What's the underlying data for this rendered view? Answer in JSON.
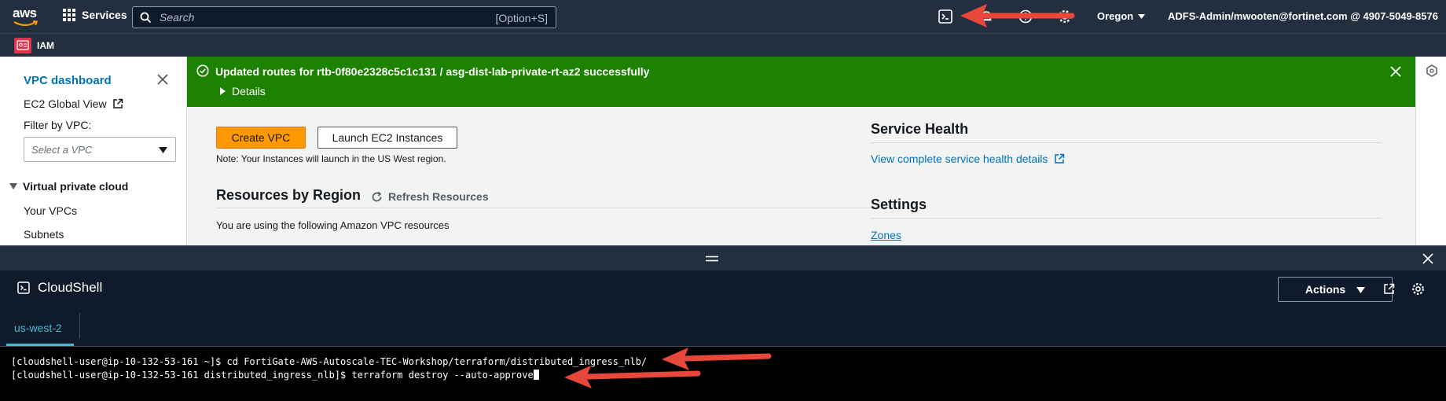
{
  "topnav": {
    "logo_text": "aws",
    "services_label": "Services",
    "search_placeholder": "Search",
    "search_shortcut": "[Option+S]",
    "region": "Oregon",
    "account": "ADFS-Admin/mwooten@fortinet.com @ 4907-5049-8576"
  },
  "subnav": {
    "service_label": "IAM"
  },
  "sidebar": {
    "title": "VPC dashboard",
    "ec2_global_view": "EC2 Global View",
    "filter_label": "Filter by VPC:",
    "filter_placeholder": "Select a VPC",
    "section_title": "Virtual private cloud",
    "items": [
      "Your VPCs",
      "Subnets"
    ]
  },
  "flash": {
    "message": "Updated routes for rtb-0f80e2328c5c1c131 / asg-dist-lab-private-rt-az2 successfully",
    "details_label": "Details"
  },
  "main": {
    "create_vpc": "Create VPC",
    "launch_ec2": "Launch EC2 Instances",
    "note": "Note: Your Instances will launch in the US West region.",
    "resources_title": "Resources by Region",
    "refresh_label": "Refresh Resources",
    "using_text": "You are using the following Amazon VPC resources",
    "service_health_title": "Service Health",
    "service_health_link": "View complete service health details",
    "settings_title": "Settings",
    "zones_link": "Zones"
  },
  "cloudshell": {
    "title": "CloudShell",
    "actions_label": "Actions",
    "tab_label": "us-west-2",
    "lines": [
      "[cloudshell-user@ip-10-132-53-161 ~]$ cd FortiGate-AWS-Autoscale-TEC-Workshop/terraform/distributed_ingress_nlb/",
      "[cloudshell-user@ip-10-132-53-161 distributed_ingress_nlb]$ terraform destroy --auto-approve"
    ]
  },
  "colors": {
    "nav_bg": "#232f3e",
    "flash_success": "#1d8102",
    "primary_button": "#ff9900",
    "link": "#0073bb",
    "annotation_arrow": "#e8483b",
    "cloudshell_tab_accent": "#44b9d6"
  },
  "icons": [
    "grid-icon",
    "search-icon",
    "cloudshell-icon",
    "bell-icon",
    "help-icon",
    "settings-icon",
    "close-icon",
    "external-link-icon",
    "check-circle-icon",
    "caret-right-icon",
    "refresh-icon",
    "drag-handle-icon",
    "gear-icon",
    "iam-icon"
  ]
}
